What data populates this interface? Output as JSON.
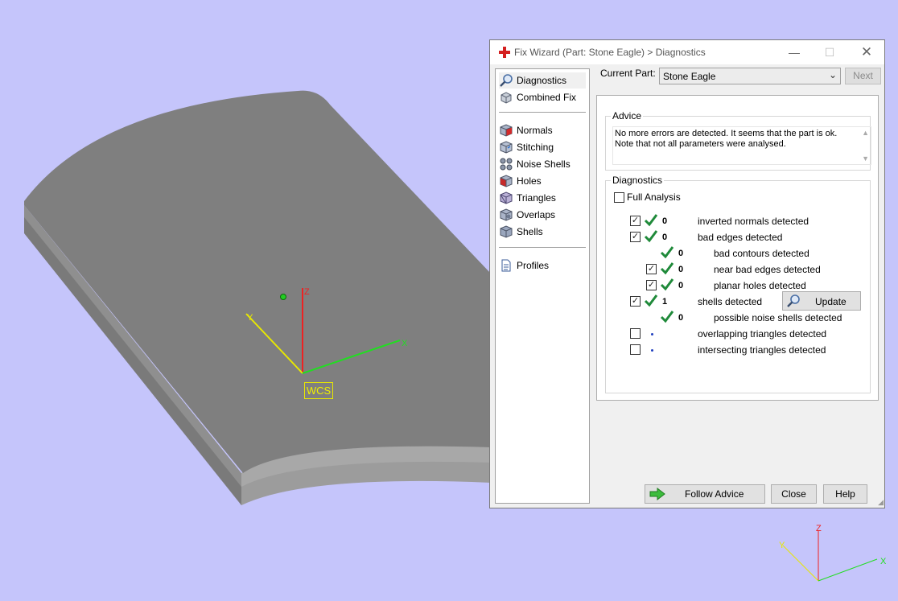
{
  "viewport": {
    "background": "#c5c5fb",
    "wcs_label": "WCS",
    "axis_x": "X",
    "axis_y": "Y",
    "axis_z": "Z",
    "mini_axis_x": "X",
    "mini_axis_y": "Y",
    "mini_axis_z": "Z",
    "colors": {
      "x_axis": "#22dd22",
      "y_axis": "#e8e800",
      "z_axis": "#ee2222",
      "part_top": "#7f7f7f"
    }
  },
  "dialog": {
    "title": "Fix Wizard (Part: Stone Eagle) > Diagnostics",
    "title_icon": "red-cross-icon",
    "controls": {
      "minimize": "—",
      "maximize": "☐",
      "close": "✕"
    },
    "nav": {
      "group1": [
        {
          "label": "Diagnostics",
          "icon": "magnifier-icon",
          "selected": true
        },
        {
          "label": "Combined Fix",
          "icon": "cube-stack-icon"
        }
      ],
      "group2": [
        {
          "label": "Normals",
          "icon": "normals-cube-icon"
        },
        {
          "label": "Stitching",
          "icon": "stitching-cube-icon"
        },
        {
          "label": "Noise Shells",
          "icon": "noise-shells-icon"
        },
        {
          "label": "Holes",
          "icon": "holes-cube-icon"
        },
        {
          "label": "Triangles",
          "icon": "triangles-cube-icon"
        },
        {
          "label": "Overlaps",
          "icon": "overlaps-cube-icon"
        },
        {
          "label": "Shells",
          "icon": "shells-cube-icon"
        }
      ],
      "group3": [
        {
          "label": "Profiles",
          "icon": "document-icon"
        }
      ]
    },
    "current_part_label": "Current Part:",
    "current_part_value": "Stone Eagle",
    "next_button": "Next",
    "advice": {
      "title": "Advice",
      "text": "No more errors are detected. It seems that the part is ok. Note that not all parameters were analysed."
    },
    "diagnostics": {
      "title": "Diagnostics",
      "full_analysis_label": "Full Analysis",
      "full_analysis_checked": false,
      "rows": [
        {
          "label": "inverted normals detected",
          "count": "0",
          "checkbox": true,
          "checked": true,
          "status": "ok",
          "indent": 0
        },
        {
          "label": "bad edges detected",
          "count": "0",
          "checkbox": true,
          "checked": true,
          "status": "ok",
          "indent": 0
        },
        {
          "label": "bad contours detected",
          "count": "0",
          "checkbox": false,
          "checked": false,
          "status": "ok",
          "indent": 1
        },
        {
          "label": "near bad edges detected",
          "count": "0",
          "checkbox": true,
          "checked": true,
          "status": "ok",
          "indent": 1
        },
        {
          "label": "planar holes detected",
          "count": "0",
          "checkbox": true,
          "checked": true,
          "status": "ok",
          "indent": 1
        },
        {
          "label": "shells detected",
          "count": "1",
          "checkbox": true,
          "checked": true,
          "status": "ok",
          "indent": 0
        },
        {
          "label": "possible noise shells detected",
          "count": "0",
          "checkbox": false,
          "checked": false,
          "status": "ok",
          "indent": 1
        },
        {
          "label": "overlapping triangles detected",
          "count": "",
          "checkbox": true,
          "checked": false,
          "status": "none",
          "indent": 0
        },
        {
          "label": "intersecting triangles detected",
          "count": "",
          "checkbox": true,
          "checked": false,
          "status": "none",
          "indent": 0
        }
      ],
      "update_button": "Update"
    },
    "buttons": {
      "follow_advice": "Follow Advice",
      "close": "Close",
      "help": "Help"
    }
  }
}
